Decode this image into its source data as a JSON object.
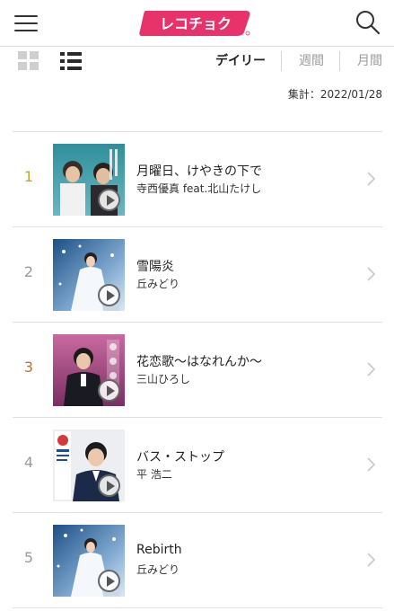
{
  "header": {
    "logo_text": "レコチョク",
    "menu_icon": "hamburger-menu-icon",
    "search_icon": "search-icon",
    "brand_color": "#e8336a"
  },
  "view_toggle": {
    "grid_icon": "grid-view-icon",
    "list_icon": "list-view-icon",
    "active": "list"
  },
  "period_tabs": [
    {
      "label": "デイリー",
      "active": true
    },
    {
      "label": "週間",
      "active": false
    },
    {
      "label": "月間",
      "active": false
    }
  ],
  "tally": "集計：2022/01/28",
  "rank_colors": {
    "gold": "#c9a227",
    "silver": "#9a9a9a",
    "bronze": "#b8732e"
  },
  "rankings": [
    {
      "rank": "1",
      "title": "月曜日、けやきの下で",
      "artist": "寺西優真 feat.北山たけし"
    },
    {
      "rank": "2",
      "title": "雪陽炎",
      "artist": "丘みどり"
    },
    {
      "rank": "3",
      "title": "花恋歌～はなれんか～",
      "artist": "三山ひろし"
    },
    {
      "rank": "4",
      "title": "バス・ストップ",
      "artist": "平 浩二"
    },
    {
      "rank": "5",
      "title": "Rebirth",
      "artist": "丘みどり"
    }
  ]
}
